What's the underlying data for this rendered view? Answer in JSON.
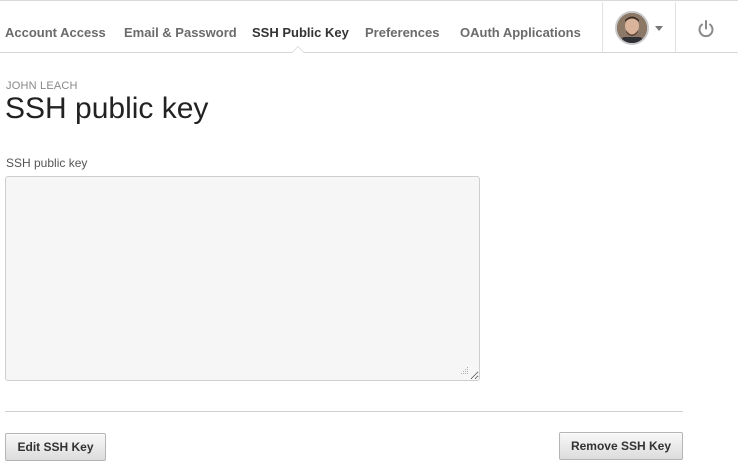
{
  "nav": {
    "tabs": [
      {
        "label": "Account Access",
        "active": false
      },
      {
        "label": "Email & Password",
        "active": false
      },
      {
        "label": "SSH Public Key",
        "active": true
      },
      {
        "label": "Preferences",
        "active": false
      },
      {
        "label": "OAuth Applications",
        "active": false
      }
    ],
    "user_menu_icon": "avatar",
    "logout_icon": "power-icon"
  },
  "header": {
    "username": "JOHN LEACH",
    "title": "SSH public key"
  },
  "form": {
    "key_label": "SSH public key",
    "key_value": ""
  },
  "actions": {
    "edit_label": "Edit SSH Key",
    "remove_label": "Remove SSH Key"
  },
  "colors": {
    "active_tab": "#333333",
    "inactive_tab": "#6b6b6b",
    "textarea_bg": "#f6f6f6"
  }
}
